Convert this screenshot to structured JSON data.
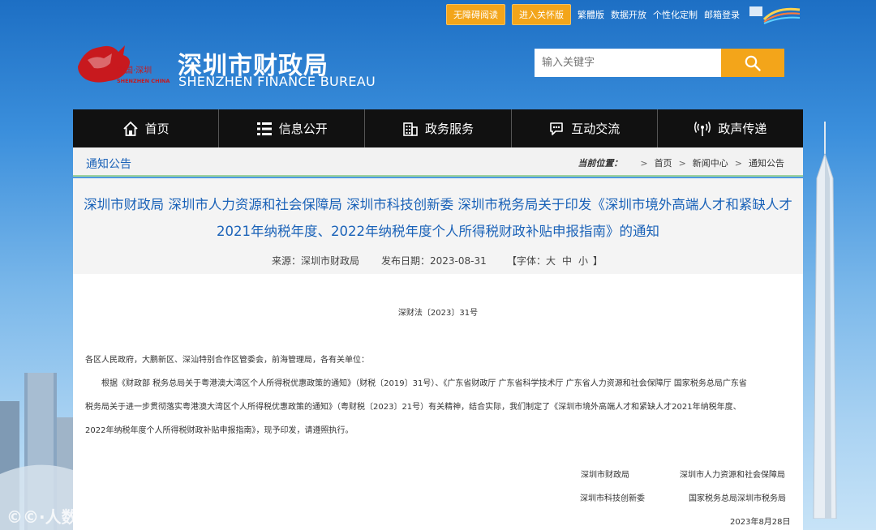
{
  "top_links": {
    "accessibility": "无障碍阅读",
    "care_edition": "进入关怀版",
    "traditional": "繁體版",
    "open_data": "数据开放",
    "custom": "个性化定制",
    "email_login": "邮箱登录"
  },
  "header": {
    "logo_text_top": "中国·深圳",
    "logo_text_bottom": "SHENZHEN CHINA",
    "title": "深圳市财政局",
    "subtitle": "SHENZHEN FINANCE BUREAU"
  },
  "search": {
    "placeholder": "输入关键字"
  },
  "nav": [
    {
      "label": "首页",
      "icon": "home-icon"
    },
    {
      "label": "信息公开",
      "icon": "list-icon"
    },
    {
      "label": "政务服务",
      "icon": "building-icon"
    },
    {
      "label": "互动交流",
      "icon": "chat-icon"
    },
    {
      "label": "政声传递",
      "icon": "broadcast-icon"
    }
  ],
  "breadcrumb": {
    "section_title": "通知公告",
    "here_label": "当前位置：",
    "items": [
      "首页",
      "新闻中心",
      "通知公告"
    ],
    "separator": ">"
  },
  "article": {
    "title_line1": "深圳市财政局 深圳市人力资源和社会保障局 深圳市科技创新委 深圳市税务局关于印发《深圳市境外高端人才和紧缺人才",
    "title_line2": "2021年纳税年度、2022年纳税年度个人所得税财政补贴申报指南》的通知",
    "source": "来源：深圳市财政局",
    "date": "发布日期：2023-08-31",
    "font_size_label": "【字体：",
    "font_large": "大",
    "font_medium": "中",
    "font_small": "小",
    "font_close": "】",
    "doc_number": "深财法〔2023〕31号",
    "salutation": "各区人民政府，大鹏新区、深汕特别合作区管委会，前海管理局，各有关单位：",
    "para_line1": "根据《财政部 税务总局关于粤港澳大湾区个人所得税优惠政策的通知》（财税〔2019〕31号）、《广东省财政厅 广东省科学技术厅 广东省人力资源和社会保障厅 国家税务总局广东省",
    "para_line2": "税务局关于进一步贯彻落实粤港澳大湾区个人所得税优惠政策的通知》（粤财税〔2023〕21号）有关精神，结合实际，我们制定了《深圳市境外高端人才和紧缺人才2021年纳税年度、",
    "para_line3": "2022年纳税年度个人所得税财政补贴申报指南》，现予印发，请遵照执行。",
    "sig_1": "深圳市财政局",
    "sig_2": "深圳市人力资源和社会保障局",
    "sig_3": "深圳市科技创新委",
    "sig_4": "国家税务总局深圳市税务局",
    "sig_date": "2023年8月28日"
  },
  "watermark": "©©·人数跨境",
  "colors": {
    "accent": "#f3a51a",
    "link_blue": "#1a62b8",
    "nav_bg": "#111111"
  }
}
